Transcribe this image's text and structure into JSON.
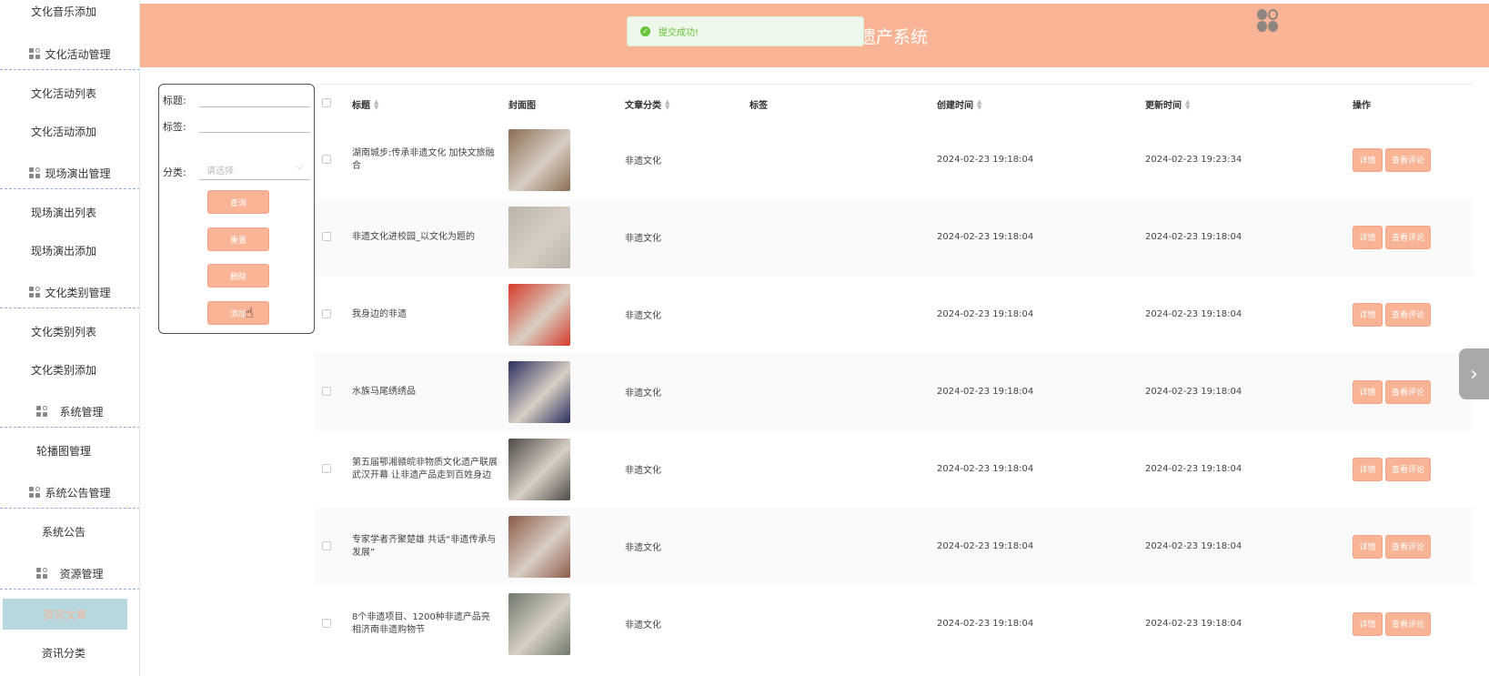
{
  "sidebar": {
    "items": [
      {
        "label": "文化音乐添加",
        "type": "item"
      },
      {
        "label": "文化活动管理",
        "type": "group"
      },
      {
        "label": "文化活动列表",
        "type": "item"
      },
      {
        "label": "文化活动添加",
        "type": "item"
      },
      {
        "label": "现场演出管理",
        "type": "group"
      },
      {
        "label": "现场演出列表",
        "type": "item"
      },
      {
        "label": "现场演出添加",
        "type": "item"
      },
      {
        "label": "文化类别管理",
        "type": "group"
      },
      {
        "label": "文化类别列表",
        "type": "item"
      },
      {
        "label": "文化类别添加",
        "type": "item"
      },
      {
        "label": "系统管理",
        "type": "group"
      },
      {
        "label": "轮播图管理",
        "type": "item"
      },
      {
        "label": "系统公告管理",
        "type": "group"
      },
      {
        "label": "系统公告",
        "type": "item"
      },
      {
        "label": "资源管理",
        "type": "group"
      },
      {
        "label": "资讯文章",
        "type": "item",
        "active": true
      },
      {
        "label": "资讯分类",
        "type": "item"
      }
    ]
  },
  "header": {
    "title": "遗产系统",
    "toast": "提交成功!"
  },
  "search": {
    "title_label": "标题:",
    "tag_label": "标签:",
    "category_label": "分类:",
    "category_placeholder": "请选择",
    "query_btn": "查询",
    "reset_btn": "重置",
    "delete_btn": "删除",
    "add_btn": "添加"
  },
  "table": {
    "headers": {
      "title": "标题",
      "cover": "封面图",
      "category": "文章分类",
      "tags": "标签",
      "created": "创建时间",
      "updated": "更新时间",
      "ops": "操作"
    },
    "detail_btn": "详情",
    "comment_btn": "查看评论",
    "rows": [
      {
        "title": "湖南城步:传承非遗文化 加快文旅融合",
        "category": "非遗文化",
        "tags": "",
        "created": "2024-02-23 19:18:04",
        "updated": "2024-02-23 19:23:34",
        "cover_color": "#8a6d55"
      },
      {
        "title": "非遗文化进校园_以文化为题的",
        "category": "非遗文化",
        "tags": "",
        "created": "2024-02-23 19:18:04",
        "updated": "2024-02-23 19:18:04",
        "cover_color": "#b9b3a9"
      },
      {
        "title": "我身边的非遗",
        "category": "非遗文化",
        "tags": "",
        "created": "2024-02-23 19:18:04",
        "updated": "2024-02-23 19:18:04",
        "cover_color": "#d63a2a"
      },
      {
        "title": "水族马尾绣绣品",
        "category": "非遗文化",
        "tags": "",
        "created": "2024-02-23 19:18:04",
        "updated": "2024-02-23 19:18:04",
        "cover_color": "#2b2f5e"
      },
      {
        "title": "第五届鄂湘赣皖非物质文化遗产联展武汉开幕 让非遗产品走到百姓身边",
        "category": "非遗文化",
        "tags": "",
        "created": "2024-02-23 19:18:04",
        "updated": "2024-02-23 19:18:04",
        "cover_color": "#4d4a46"
      },
      {
        "title": "专家学者齐聚楚雄 共话“非遗传承与发展”",
        "category": "非遗文化",
        "tags": "",
        "created": "2024-02-23 19:18:04",
        "updated": "2024-02-23 19:18:04",
        "cover_color": "#8c5a4a"
      },
      {
        "title": "8个非遗项目、1200种非遗产品亮相济南非遗购物节",
        "category": "非遗文化",
        "tags": "",
        "created": "2024-02-23 19:18:04",
        "updated": "2024-02-23 19:18:04",
        "cover_color": "#6e7a6c"
      }
    ]
  }
}
